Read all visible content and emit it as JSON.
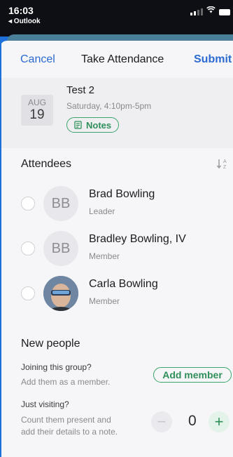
{
  "status": {
    "time": "16:03",
    "back_label": "◂ Outlook"
  },
  "nav": {
    "cancel": "Cancel",
    "title": "Take Attendance",
    "submit": "Submit"
  },
  "event": {
    "month": "AUG",
    "day": "19",
    "title": "Test 2",
    "time": "Saturday, 4:10pm-5pm",
    "notes_label": "Notes"
  },
  "attendees": {
    "heading": "Attendees",
    "people": [
      {
        "initials": "BB",
        "name": "Brad Bowling",
        "role": "Leader"
      },
      {
        "initials": "BB",
        "name": "Bradley Bowling, IV",
        "role": "Member"
      },
      {
        "initials": "",
        "name": "Carla Bowling",
        "role": "Member"
      }
    ]
  },
  "new_people": {
    "heading": "New people",
    "joining_label": "Joining this group?",
    "joining_sub": "Add them as a member.",
    "add_member": "Add member",
    "visiting_label": "Just visiting?",
    "visiting_sub_1": "Count them present and",
    "visiting_sub_2": "add their details to a note.",
    "count": "0",
    "minus": "−",
    "plus": "+"
  },
  "colors": {
    "accent_blue": "#2a6ad1",
    "accent_green": "#2f8f5a",
    "background": "#f6f6f8"
  }
}
